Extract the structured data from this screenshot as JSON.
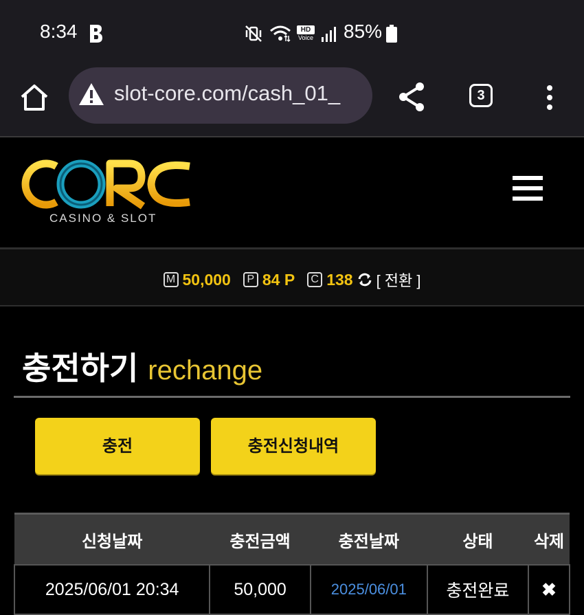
{
  "status_bar": {
    "time": "8:34",
    "battery": "85%",
    "hd_label": "HD",
    "voice_label": "Voice"
  },
  "browser": {
    "url": "slot-core.com/cash_01_",
    "tab_count": "3"
  },
  "site": {
    "logo_text": "CORE",
    "logo_sub": "CASINO & SLOT",
    "colors": {
      "accent": "#f2c311",
      "button": "#f3d21a",
      "link": "#4b8fe0"
    }
  },
  "balance": {
    "money_badge": "M",
    "money": "50,000",
    "point_badge": "P",
    "points": "84 P",
    "coin_badge": "C",
    "coins": "138",
    "switch_label": "[ 전환 ]"
  },
  "page": {
    "title_ko": "충전하기",
    "title_en": "rechange"
  },
  "buttons": {
    "charge": "충전",
    "history": "충전신청내역"
  },
  "table": {
    "headers": [
      "신청날짜",
      "충전금액",
      "충전날짜",
      "상태",
      "삭제"
    ],
    "rows": [
      [
        "2025/06/01 20:34",
        "50,000",
        "2025/06/01",
        "충전완료",
        "✖"
      ]
    ]
  }
}
